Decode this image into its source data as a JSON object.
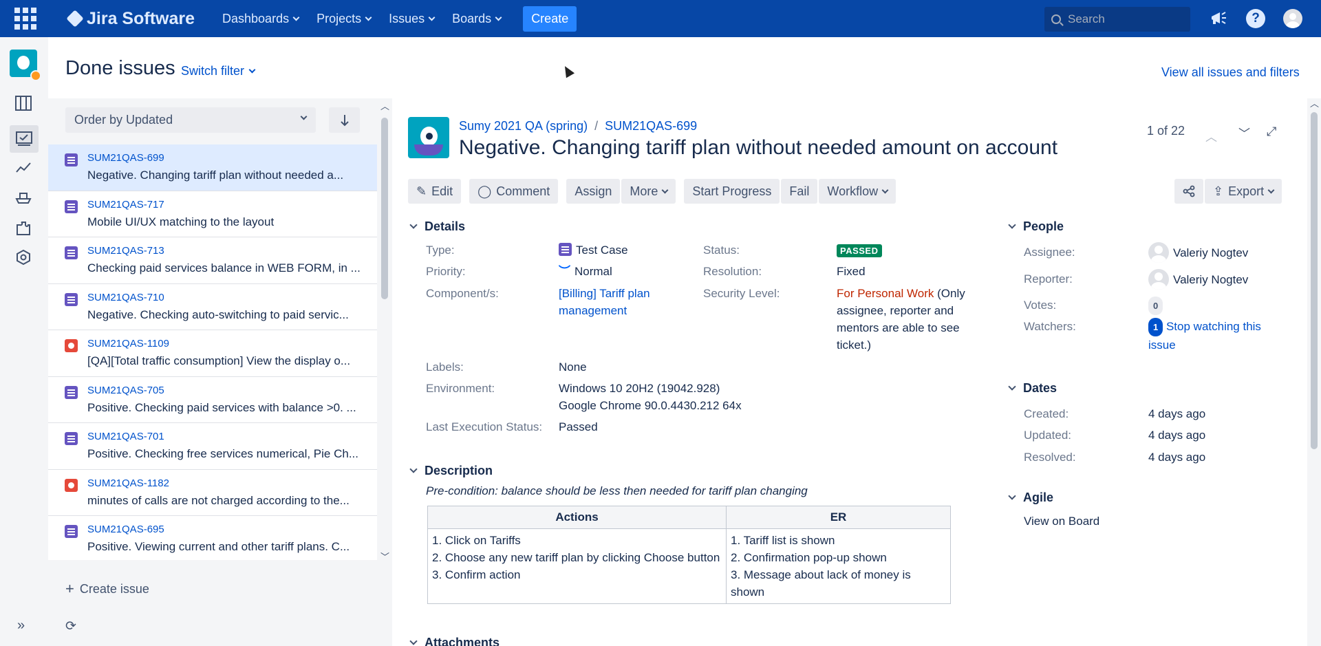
{
  "topnav": {
    "app_name": "Jira Software",
    "menu": [
      {
        "label": "Dashboards"
      },
      {
        "label": "Projects"
      },
      {
        "label": "Issues"
      },
      {
        "label": "Boards"
      }
    ],
    "create_label": "Create",
    "search_placeholder": "Search"
  },
  "header": {
    "title": "Done issues",
    "switch_filter": "Switch filter",
    "view_all": "View all issues and filters"
  },
  "list": {
    "order_by": "Order by Updated",
    "items": [
      {
        "key": "SUM21QAS-699",
        "summary": "Negative. Changing tariff plan without needed a...",
        "type": "test"
      },
      {
        "key": "SUM21QAS-717",
        "summary": "Mobile UI/UX matching to the layout",
        "type": "test"
      },
      {
        "key": "SUM21QAS-713",
        "summary": "Checking paid services balance in WEB FORM, in ...",
        "type": "test"
      },
      {
        "key": "SUM21QAS-710",
        "summary": "Negative. Checking auto-switching to paid servic...",
        "type": "test"
      },
      {
        "key": "SUM21QAS-1109",
        "summary": "[QA][Total traffic consumption] View the display o...",
        "type": "bug"
      },
      {
        "key": "SUM21QAS-705",
        "summary": "Positive. Checking paid services with balance >0. ...",
        "type": "test"
      },
      {
        "key": "SUM21QAS-701",
        "summary": "Positive. Checking free services numerical, Pie Ch...",
        "type": "test"
      },
      {
        "key": "SUM21QAS-1182",
        "summary": "minutes of calls are not charged according to the...",
        "type": "bug"
      },
      {
        "key": "SUM21QAS-695",
        "summary": "Positive. Viewing current and other tariff plans. C...",
        "type": "test"
      }
    ],
    "create_issue": "Create issue"
  },
  "issue": {
    "project": "Sumy 2021 QA (spring)",
    "key": "SUM21QAS-699",
    "title": "Negative. Changing tariff plan without needed amount on account",
    "pager": "1 of 22",
    "actions": {
      "edit": "Edit",
      "comment": "Comment",
      "assign": "Assign",
      "more": "More",
      "start_progress": "Start Progress",
      "fail": "Fail",
      "workflow": "Workflow",
      "export": "Export"
    },
    "details": {
      "heading": "Details",
      "type_label": "Type:",
      "type_value": "Test Case",
      "priority_label": "Priority:",
      "priority_value": "Normal",
      "component_label": "Component/s:",
      "component_value": "[Billing] Tariff plan management",
      "status_label": "Status:",
      "status_value": "PASSED",
      "resolution_label": "Resolution:",
      "resolution_value": "Fixed",
      "security_label": "Security Level:",
      "security_value": "For Personal Work",
      "security_note": " (Only assignee, reporter and mentors are able to see ticket.)",
      "labels_label": "Labels:",
      "labels_value": "None",
      "environment_label": "Environment:",
      "environment_line1": "Windows 10 20H2 (19042.928)",
      "environment_line2": "Google Chrome 90.0.4430.212 64x",
      "last_exec_label": "Last Execution Status:",
      "last_exec_value": "Passed"
    },
    "description": {
      "heading": "Description",
      "precondition": "Pre-condition: balance should be less then needed for tariff plan changing",
      "table_headers": [
        "Actions",
        "ER"
      ],
      "actions": [
        "1. Click on Tariffs",
        "2. Choose any new tariff plan by clicking Choose button",
        "3. Confirm action"
      ],
      "er": [
        "1. Tariff list is shown",
        "2. Confirmation pop-up shown",
        "3. Message about lack of money is shown"
      ]
    },
    "attachments_heading": "Attachments",
    "people": {
      "heading": "People",
      "assignee_label": "Assignee:",
      "assignee": "Valeriy Nogtev",
      "reporter_label": "Reporter:",
      "reporter": "Valeriy Nogtev",
      "votes_label": "Votes:",
      "votes": "0",
      "watchers_label": "Watchers:",
      "watchers": "1",
      "stop_watching": "Stop watching this issue"
    },
    "dates": {
      "heading": "Dates",
      "created_label": "Created:",
      "created": "4 days ago",
      "updated_label": "Updated:",
      "updated": "4 days ago",
      "resolved_label": "Resolved:",
      "resolved": "4 days ago"
    },
    "agile": {
      "heading": "Agile",
      "view_on_board": "View on Board"
    }
  },
  "colors": {
    "nav_bg": "#0747a6",
    "link": "#0052cc",
    "status_passed": "#00875a",
    "security": "#bf2600"
  }
}
